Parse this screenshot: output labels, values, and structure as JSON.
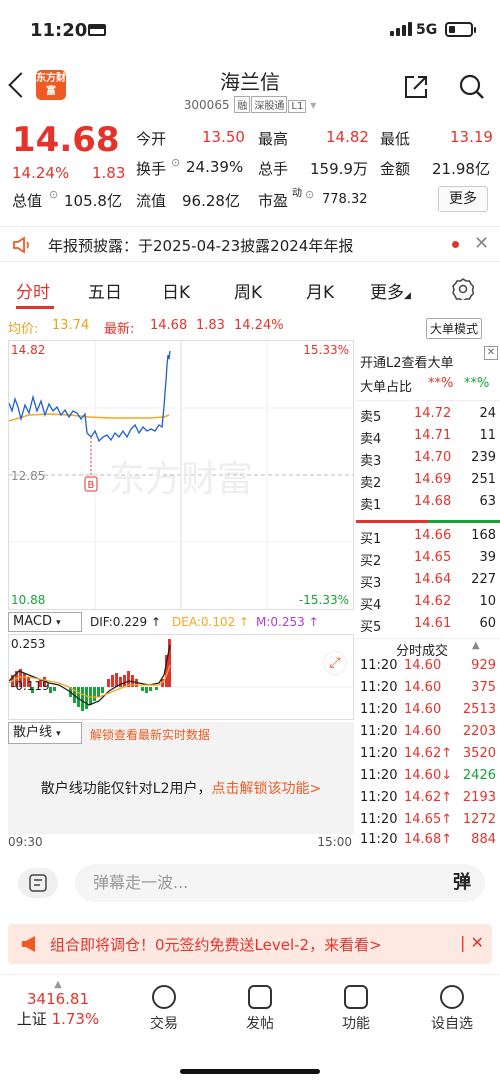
{
  "status_bar": {
    "time": "11:20",
    "network": "5G"
  },
  "header": {
    "logo_text": "东方财富",
    "title": "海兰信",
    "code": "300065",
    "tags": [
      "融",
      "深股通",
      "L1"
    ]
  },
  "quote": {
    "price": "14.68",
    "change_pct": "14.24%",
    "change": "1.83",
    "open_label": "今开",
    "open": "13.50",
    "high_label": "最高",
    "high": "14.82",
    "low_label": "最低",
    "low": "13.19",
    "turnover_label": "换手",
    "turnover": "24.39%",
    "volume_label": "总手",
    "volume": "159.9万",
    "amount_label": "金额",
    "amount": "21.98亿",
    "mktcap_label": "总值",
    "mktcap": "105.8亿",
    "float_label": "流值",
    "float_cap": "96.28亿",
    "pe_label": "市盈",
    "pe_sup": "动",
    "pe": "778.32",
    "more_label": "更多"
  },
  "notice": {
    "text": "年报预披露：于2025-04-23披露2024年年报"
  },
  "tabs": [
    "分时",
    "五日",
    "日K",
    "周K",
    "月K",
    "更多"
  ],
  "avg_line": {
    "avg_label": "均价:",
    "avg": "13.74",
    "latest_label": "最新:",
    "latest": "14.68",
    "chg": "1.83",
    "chg_pct": "14.24%",
    "mode_btn": "大单模式"
  },
  "main_chart": {
    "top_price": "14.82",
    "top_pct": "15.33%",
    "mid_price": "12.85",
    "bot_price": "10.88",
    "bot_pct": "-15.33%",
    "marker": "B",
    "watermark": "东方财富"
  },
  "macd": {
    "label": "MACD",
    "dif": "DIF:0.229 ↑",
    "dea": "DEA:0.102 ↑",
    "m": "M:0.253 ↑",
    "top": "0.253",
    "bottom": "-0.119",
    "colors": {
      "dif": "#222222",
      "dea": "#f5a623",
      "m": "#b03cd8"
    }
  },
  "sanhu": {
    "label": "散户线",
    "unlock_hint": "解锁查看最新实时数据",
    "message": "散户线功能仅针对L2用户，",
    "link": "点击解锁该功能>"
  },
  "time_axis": {
    "start": "09:30",
    "end": "15:00"
  },
  "order_book": {
    "l2_text": "开通L2查看大单",
    "ratio_label": "大单占比",
    "ratio_red": "**%",
    "ratio_green": "**%",
    "asks": [
      {
        "label": "卖5",
        "price": "14.72",
        "vol": "24"
      },
      {
        "label": "卖4",
        "price": "14.71",
        "vol": "11"
      },
      {
        "label": "卖3",
        "price": "14.70",
        "vol": "239"
      },
      {
        "label": "卖2",
        "price": "14.69",
        "vol": "251"
      },
      {
        "label": "卖1",
        "price": "14.68",
        "vol": "63"
      }
    ],
    "bids": [
      {
        "label": "买1",
        "price": "14.66",
        "vol": "168"
      },
      {
        "label": "买2",
        "price": "14.65",
        "vol": "39"
      },
      {
        "label": "买3",
        "price": "14.64",
        "vol": "227"
      },
      {
        "label": "买4",
        "price": "14.62",
        "vol": "10"
      },
      {
        "label": "买5",
        "price": "14.61",
        "vol": "60"
      }
    ],
    "ticks_title": "分时成交",
    "ticks": [
      {
        "time": "11:20",
        "price": "14.60",
        "vol": "929",
        "color": "red"
      },
      {
        "time": "11:20",
        "price": "14.60",
        "vol": "375",
        "color": "red"
      },
      {
        "time": "11:20",
        "price": "14.60",
        "vol": "2513",
        "color": "red"
      },
      {
        "time": "11:20",
        "price": "14.60",
        "vol": "2203",
        "color": "red"
      },
      {
        "time": "11:20",
        "price": "14.62↑",
        "vol": "3520",
        "color": "red"
      },
      {
        "time": "11:20",
        "price": "14.60↓",
        "vol": "2426",
        "color": "green"
      },
      {
        "time": "11:20",
        "price": "14.62↑",
        "vol": "2193",
        "color": "red"
      },
      {
        "time": "11:20",
        "price": "14.65↑",
        "vol": "1272",
        "color": "red"
      },
      {
        "time": "11:20",
        "price": "14.68↑",
        "vol": "884",
        "color": "red"
      }
    ]
  },
  "danmu": {
    "placeholder": "弹幕走一波...",
    "btn": "弹"
  },
  "promo": {
    "text": "组合即将调仓！0元签约免费送Level-2，来看看>"
  },
  "bottom_bar": {
    "index_value": "3416.81",
    "index_name": "上证",
    "index_pct": "1.73%",
    "items": [
      "交易",
      "发帖",
      "功能",
      "设自选"
    ]
  }
}
